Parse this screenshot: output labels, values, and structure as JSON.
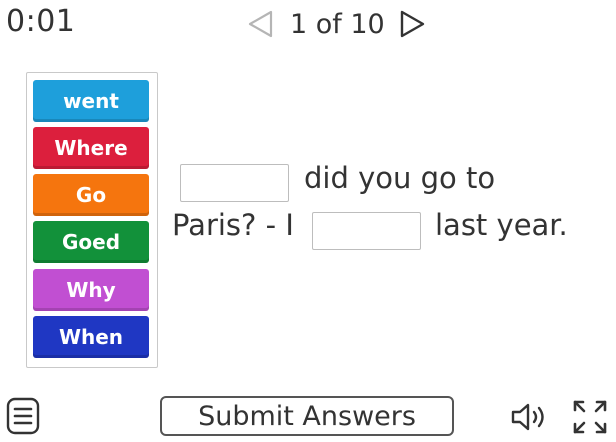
{
  "header": {
    "timer": "0:01",
    "page_indicator": "1 of 10",
    "prev_icon": "triangle-left-icon",
    "next_icon": "triangle-right-icon"
  },
  "word_bank": {
    "tiles": [
      {
        "label": "went",
        "color": "#1e9fdb"
      },
      {
        "label": "Where",
        "color": "#dc1f3d"
      },
      {
        "label": "Go",
        "color": "#f5750e"
      },
      {
        "label": "Goed",
        "color": "#12913a"
      },
      {
        "label": "Why",
        "color": "#c14fd2"
      },
      {
        "label": "When",
        "color": "#1f37c3"
      }
    ]
  },
  "question": {
    "part_1": "did you go to",
    "part_2": "Paris? - I",
    "part_3": "last year."
  },
  "footer": {
    "submit_label": "Submit Answers",
    "menu_icon": "menu-icon",
    "sound_icon": "speaker-icon",
    "fullscreen_icon": "fullscreen-icon"
  }
}
